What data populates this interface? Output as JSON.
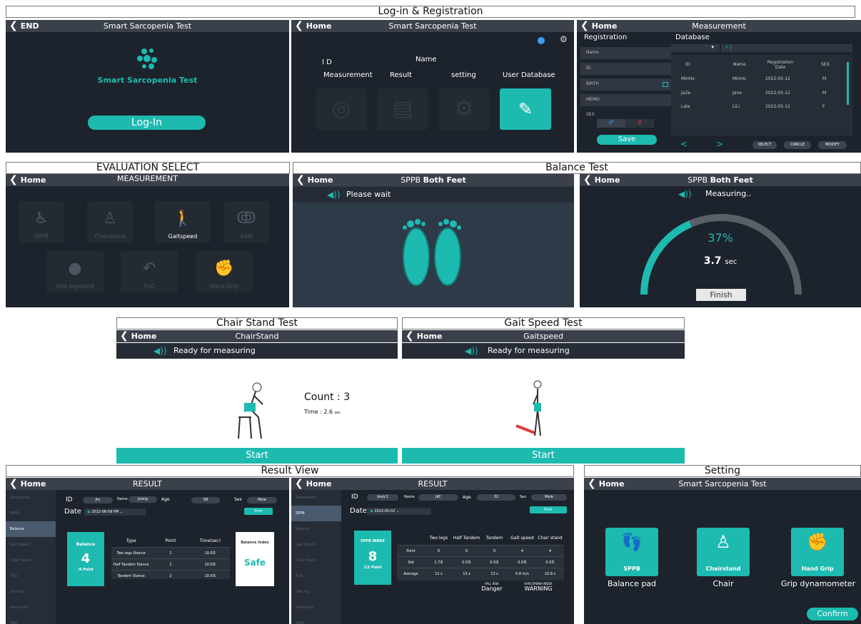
{
  "sections": {
    "login": "Log-in & Registration",
    "eval": "EVALUATION SELECT",
    "balance": "Balance Test",
    "chair": "Chair Stand Test",
    "gait": "Gait Speed Test",
    "result": "Result View",
    "setting": "Setting"
  },
  "common": {
    "home": "Home",
    "app_title": "Smart Sarcopenia Test",
    "back_glyph": "❮"
  },
  "login_screen": {
    "end": "END",
    "brand": "Smart Sarcopenia Test",
    "login_btn": "Log-In"
  },
  "menu_screen": {
    "id_label": "I D",
    "name_label": "Name",
    "items": [
      "Measurement",
      "Result",
      "setting",
      "User Database"
    ]
  },
  "measurement_screen": {
    "title": "Measurement",
    "registration": "Registration",
    "database": "Database",
    "fields": [
      "Name",
      "ID",
      "BIRTH",
      "MEMO",
      "SEX"
    ],
    "save": "Save",
    "columns": [
      "ID",
      "Name",
      "Registration Date",
      "SEX"
    ],
    "rows": [
      [
        "MinHo",
        "MinHo",
        "2022-05-12",
        "M"
      ],
      [
        "JaZe",
        "Jane",
        "2022-05-12",
        "M"
      ],
      [
        "Lala",
        "LiLi",
        "2022-05-12",
        "F"
      ]
    ],
    "buttons": [
      "SELECT",
      "CANCLE",
      "MODIFY"
    ],
    "prev": "<",
    "next": ">"
  },
  "eval_screen": {
    "title": "MEASUREMENT",
    "tiles": [
      "SPPB",
      "Chairstand",
      "Gaitspeed",
      "ASM",
      "One legstand",
      "TUG",
      "Hand Grip"
    ]
  },
  "balance_wait": {
    "title_a": "SPPB",
    "title_b": "Both Feet",
    "msg": "Please wait"
  },
  "balance_measure": {
    "title_a": "SPPB",
    "title_b": "Both Feet",
    "msg": "Measuring..",
    "percent": "37%",
    "time": "3.7",
    "unit": "sec",
    "finish": "Finish",
    "progress": 0.37
  },
  "chair_screen": {
    "title": "ChairStand",
    "msg": "Ready for measuring",
    "count": "Count : 3",
    "time": "Time : 2.6",
    "unit": "sec",
    "start": "Start"
  },
  "gait_screen": {
    "title": "Gaitspeed",
    "msg": "Ready for measuring",
    "start": "Start"
  },
  "result1": {
    "title": "RESULT",
    "id_label": "ID",
    "id": "jhc",
    "name_label": "Name",
    "name": "Jeong",
    "age_label": "Age",
    "age": "58",
    "sex_label": "Sex",
    "sex": "Male",
    "date_label": "Date",
    "date": "2022-06-09 PM",
    "print": "Print",
    "sidebar": [
      "Sarcopenia",
      "SPPB",
      "Balance",
      "Gait Speed",
      "Chair Stand",
      "TUG",
      "One leg",
      "Hand Grip",
      "ASM"
    ],
    "card_title": "Balance",
    "score": "4",
    "max": "/4 Point",
    "cols": [
      "Type",
      "Point",
      "Time(sec)"
    ],
    "rows": [
      [
        "Two legs Stance",
        "1",
        "10.0초"
      ],
      [
        "Half Tandem Stance",
        "1",
        "10.0초"
      ],
      [
        "Tandem Stance",
        "2",
        "10.0초"
      ]
    ],
    "index_title": "Balance Index",
    "index_value": "Safe"
  },
  "result2": {
    "title": "RESULT",
    "id_label": "ID",
    "id": "testc1",
    "name_label": "Name",
    "name": "JKC",
    "age_label": "Age",
    "age": "32",
    "sex_label": "Sex",
    "sex": "Male",
    "date_label": "Date",
    "date": "2022-05-02",
    "print": "Print",
    "sidebar": [
      "Sarcopenia",
      "SPPB",
      "Balance",
      "Gait Speed",
      "Chair Stand",
      "TUG",
      "One leg",
      "Hand Grip",
      "ASM"
    ],
    "card_title": "SPPB INDEX",
    "score": "8",
    "max": "/12 Point",
    "cols": [
      "",
      "Two legs",
      "Half Tandem",
      "Tandem",
      "Gait speed",
      "Chair stand"
    ],
    "rows": [
      [
        "Point",
        "0",
        "0",
        "0",
        "4",
        "4"
      ],
      [
        "Std",
        "1.7초",
        "0.0초",
        "0.0초",
        "0.0초",
        "0.0초"
      ],
      [
        "Average",
        "11 s",
        "13 s",
        "13 s",
        "0.8 m/s",
        "10.9 s"
      ]
    ],
    "fall_label": "FALL RISK",
    "fall": "Danger",
    "sarco_label": "SARCOPENIA INDEX",
    "sarco": "WARNING"
  },
  "setting_screen": {
    "tiles": [
      "SPPB",
      "Chairstand",
      "Hand Grip"
    ],
    "captions": [
      "Balance pad",
      "Chair",
      "Grip dynamometer"
    ],
    "confirm": "Confirm"
  },
  "colors": {
    "teal": "#1dbab0",
    "panel": "#1d232c",
    "bar": "#3b414b"
  }
}
